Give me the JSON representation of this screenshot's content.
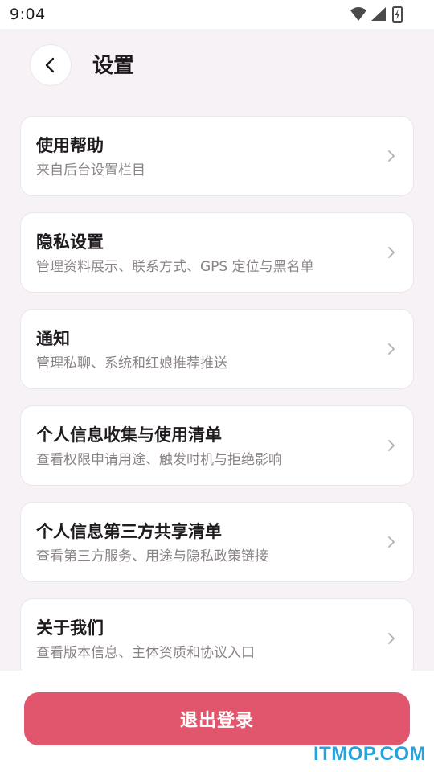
{
  "status_bar": {
    "time": "9:04",
    "icons": [
      "wifi-icon",
      "signal-icon",
      "battery-charging-icon"
    ]
  },
  "header": {
    "back_icon": "chevron-left-icon",
    "title": "设置"
  },
  "settings": [
    {
      "title": "使用帮助",
      "subtitle": "来自后台设置栏目"
    },
    {
      "title": "隐私设置",
      "subtitle": "管理资料展示、联系方式、GPS 定位与黑名单"
    },
    {
      "title": "通知",
      "subtitle": "管理私聊、系统和红娘推荐推送"
    },
    {
      "title": "个人信息收集与使用清单",
      "subtitle": "查看权限申请用途、触发时机与拒绝影响"
    },
    {
      "title": "个人信息第三方共享清单",
      "subtitle": "查看第三方服务、用途与隐私政策链接"
    },
    {
      "title": "关于我们",
      "subtitle": "查看版本信息、主体资质和协议入口"
    }
  ],
  "logout_label": "退出登录",
  "watermark": "ITMOP.COM",
  "colors": {
    "background": "#f6f2f5",
    "card": "#ffffff",
    "accent": "#e1566c",
    "watermark": "#27a2dc"
  }
}
